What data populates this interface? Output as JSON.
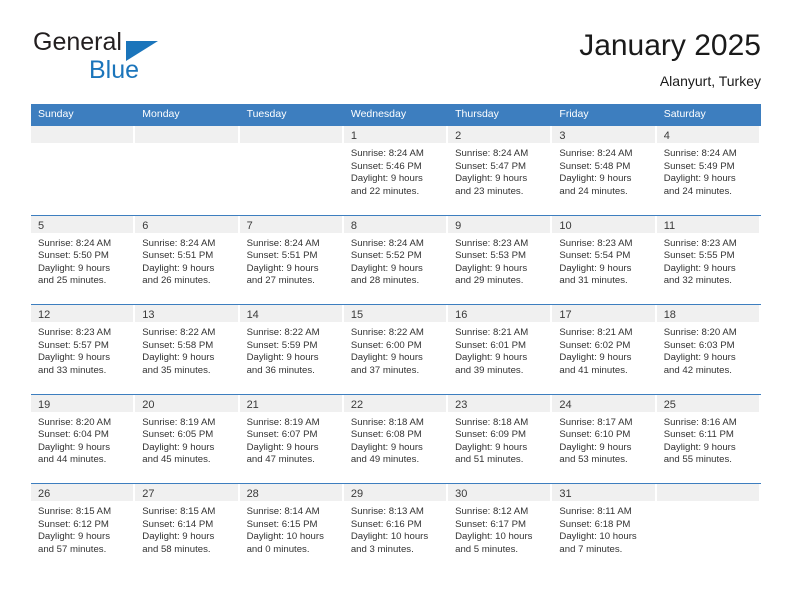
{
  "brand": {
    "name_top": "General",
    "name_bottom": "Blue",
    "triangle_color": "#1b75bb"
  },
  "header": {
    "title": "January 2025",
    "subtitle": "Alanyurt, Turkey"
  },
  "theme": {
    "header_blue": "#3d7ebf",
    "day_band_gray": "#f0f0f0",
    "text": "#333333"
  },
  "weekdays": [
    "Sunday",
    "Monday",
    "Tuesday",
    "Wednesday",
    "Thursday",
    "Friday",
    "Saturday"
  ],
  "weeks": [
    [
      {
        "day": "",
        "sunrise": "",
        "sunset": "",
        "daylight_line1": "",
        "daylight_line2": ""
      },
      {
        "day": "",
        "sunrise": "",
        "sunset": "",
        "daylight_line1": "",
        "daylight_line2": ""
      },
      {
        "day": "",
        "sunrise": "",
        "sunset": "",
        "daylight_line1": "",
        "daylight_line2": ""
      },
      {
        "day": "1",
        "sunrise": "Sunrise: 8:24 AM",
        "sunset": "Sunset: 5:46 PM",
        "daylight_line1": "Daylight: 9 hours",
        "daylight_line2": "and 22 minutes."
      },
      {
        "day": "2",
        "sunrise": "Sunrise: 8:24 AM",
        "sunset": "Sunset: 5:47 PM",
        "daylight_line1": "Daylight: 9 hours",
        "daylight_line2": "and 23 minutes."
      },
      {
        "day": "3",
        "sunrise": "Sunrise: 8:24 AM",
        "sunset": "Sunset: 5:48 PM",
        "daylight_line1": "Daylight: 9 hours",
        "daylight_line2": "and 24 minutes."
      },
      {
        "day": "4",
        "sunrise": "Sunrise: 8:24 AM",
        "sunset": "Sunset: 5:49 PM",
        "daylight_line1": "Daylight: 9 hours",
        "daylight_line2": "and 24 minutes."
      }
    ],
    [
      {
        "day": "5",
        "sunrise": "Sunrise: 8:24 AM",
        "sunset": "Sunset: 5:50 PM",
        "daylight_line1": "Daylight: 9 hours",
        "daylight_line2": "and 25 minutes."
      },
      {
        "day": "6",
        "sunrise": "Sunrise: 8:24 AM",
        "sunset": "Sunset: 5:51 PM",
        "daylight_line1": "Daylight: 9 hours",
        "daylight_line2": "and 26 minutes."
      },
      {
        "day": "7",
        "sunrise": "Sunrise: 8:24 AM",
        "sunset": "Sunset: 5:51 PM",
        "daylight_line1": "Daylight: 9 hours",
        "daylight_line2": "and 27 minutes."
      },
      {
        "day": "8",
        "sunrise": "Sunrise: 8:24 AM",
        "sunset": "Sunset: 5:52 PM",
        "daylight_line1": "Daylight: 9 hours",
        "daylight_line2": "and 28 minutes."
      },
      {
        "day": "9",
        "sunrise": "Sunrise: 8:23 AM",
        "sunset": "Sunset: 5:53 PM",
        "daylight_line1": "Daylight: 9 hours",
        "daylight_line2": "and 29 minutes."
      },
      {
        "day": "10",
        "sunrise": "Sunrise: 8:23 AM",
        "sunset": "Sunset: 5:54 PM",
        "daylight_line1": "Daylight: 9 hours",
        "daylight_line2": "and 31 minutes."
      },
      {
        "day": "11",
        "sunrise": "Sunrise: 8:23 AM",
        "sunset": "Sunset: 5:55 PM",
        "daylight_line1": "Daylight: 9 hours",
        "daylight_line2": "and 32 minutes."
      }
    ],
    [
      {
        "day": "12",
        "sunrise": "Sunrise: 8:23 AM",
        "sunset": "Sunset: 5:57 PM",
        "daylight_line1": "Daylight: 9 hours",
        "daylight_line2": "and 33 minutes."
      },
      {
        "day": "13",
        "sunrise": "Sunrise: 8:22 AM",
        "sunset": "Sunset: 5:58 PM",
        "daylight_line1": "Daylight: 9 hours",
        "daylight_line2": "and 35 minutes."
      },
      {
        "day": "14",
        "sunrise": "Sunrise: 8:22 AM",
        "sunset": "Sunset: 5:59 PM",
        "daylight_line1": "Daylight: 9 hours",
        "daylight_line2": "and 36 minutes."
      },
      {
        "day": "15",
        "sunrise": "Sunrise: 8:22 AM",
        "sunset": "Sunset: 6:00 PM",
        "daylight_line1": "Daylight: 9 hours",
        "daylight_line2": "and 37 minutes."
      },
      {
        "day": "16",
        "sunrise": "Sunrise: 8:21 AM",
        "sunset": "Sunset: 6:01 PM",
        "daylight_line1": "Daylight: 9 hours",
        "daylight_line2": "and 39 minutes."
      },
      {
        "day": "17",
        "sunrise": "Sunrise: 8:21 AM",
        "sunset": "Sunset: 6:02 PM",
        "daylight_line1": "Daylight: 9 hours",
        "daylight_line2": "and 41 minutes."
      },
      {
        "day": "18",
        "sunrise": "Sunrise: 8:20 AM",
        "sunset": "Sunset: 6:03 PM",
        "daylight_line1": "Daylight: 9 hours",
        "daylight_line2": "and 42 minutes."
      }
    ],
    [
      {
        "day": "19",
        "sunrise": "Sunrise: 8:20 AM",
        "sunset": "Sunset: 6:04 PM",
        "daylight_line1": "Daylight: 9 hours",
        "daylight_line2": "and 44 minutes."
      },
      {
        "day": "20",
        "sunrise": "Sunrise: 8:19 AM",
        "sunset": "Sunset: 6:05 PM",
        "daylight_line1": "Daylight: 9 hours",
        "daylight_line2": "and 45 minutes."
      },
      {
        "day": "21",
        "sunrise": "Sunrise: 8:19 AM",
        "sunset": "Sunset: 6:07 PM",
        "daylight_line1": "Daylight: 9 hours",
        "daylight_line2": "and 47 minutes."
      },
      {
        "day": "22",
        "sunrise": "Sunrise: 8:18 AM",
        "sunset": "Sunset: 6:08 PM",
        "daylight_line1": "Daylight: 9 hours",
        "daylight_line2": "and 49 minutes."
      },
      {
        "day": "23",
        "sunrise": "Sunrise: 8:18 AM",
        "sunset": "Sunset: 6:09 PM",
        "daylight_line1": "Daylight: 9 hours",
        "daylight_line2": "and 51 minutes."
      },
      {
        "day": "24",
        "sunrise": "Sunrise: 8:17 AM",
        "sunset": "Sunset: 6:10 PM",
        "daylight_line1": "Daylight: 9 hours",
        "daylight_line2": "and 53 minutes."
      },
      {
        "day": "25",
        "sunrise": "Sunrise: 8:16 AM",
        "sunset": "Sunset: 6:11 PM",
        "daylight_line1": "Daylight: 9 hours",
        "daylight_line2": "and 55 minutes."
      }
    ],
    [
      {
        "day": "26",
        "sunrise": "Sunrise: 8:15 AM",
        "sunset": "Sunset: 6:12 PM",
        "daylight_line1": "Daylight: 9 hours",
        "daylight_line2": "and 57 minutes."
      },
      {
        "day": "27",
        "sunrise": "Sunrise: 8:15 AM",
        "sunset": "Sunset: 6:14 PM",
        "daylight_line1": "Daylight: 9 hours",
        "daylight_line2": "and 58 minutes."
      },
      {
        "day": "28",
        "sunrise": "Sunrise: 8:14 AM",
        "sunset": "Sunset: 6:15 PM",
        "daylight_line1": "Daylight: 10 hours",
        "daylight_line2": "and 0 minutes."
      },
      {
        "day": "29",
        "sunrise": "Sunrise: 8:13 AM",
        "sunset": "Sunset: 6:16 PM",
        "daylight_line1": "Daylight: 10 hours",
        "daylight_line2": "and 3 minutes."
      },
      {
        "day": "30",
        "sunrise": "Sunrise: 8:12 AM",
        "sunset": "Sunset: 6:17 PM",
        "daylight_line1": "Daylight: 10 hours",
        "daylight_line2": "and 5 minutes."
      },
      {
        "day": "31",
        "sunrise": "Sunrise: 8:11 AM",
        "sunset": "Sunset: 6:18 PM",
        "daylight_line1": "Daylight: 10 hours",
        "daylight_line2": "and 7 minutes."
      },
      {
        "day": "",
        "sunrise": "",
        "sunset": "",
        "daylight_line1": "",
        "daylight_line2": ""
      }
    ]
  ]
}
